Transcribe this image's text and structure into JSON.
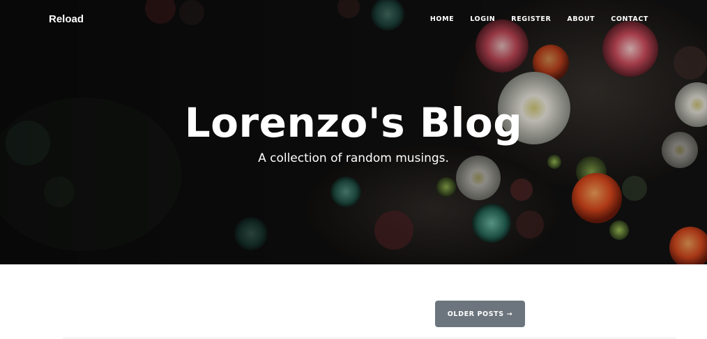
{
  "navbar": {
    "brand": "Reload",
    "links": [
      "HOME",
      "LOGIN",
      "REGISTER",
      "ABOUT",
      "CONTACT"
    ]
  },
  "hero": {
    "title": "Lorenzo's Blog",
    "subtitle": "A collection of random musings."
  },
  "pager": {
    "older_label": "OLDER POSTS",
    "older_icon": "arrow-right-icon"
  },
  "colors": {
    "hero_background": "#0e0d0d",
    "button_background": "#6c757d",
    "text_on_dark": "#ffffff"
  }
}
